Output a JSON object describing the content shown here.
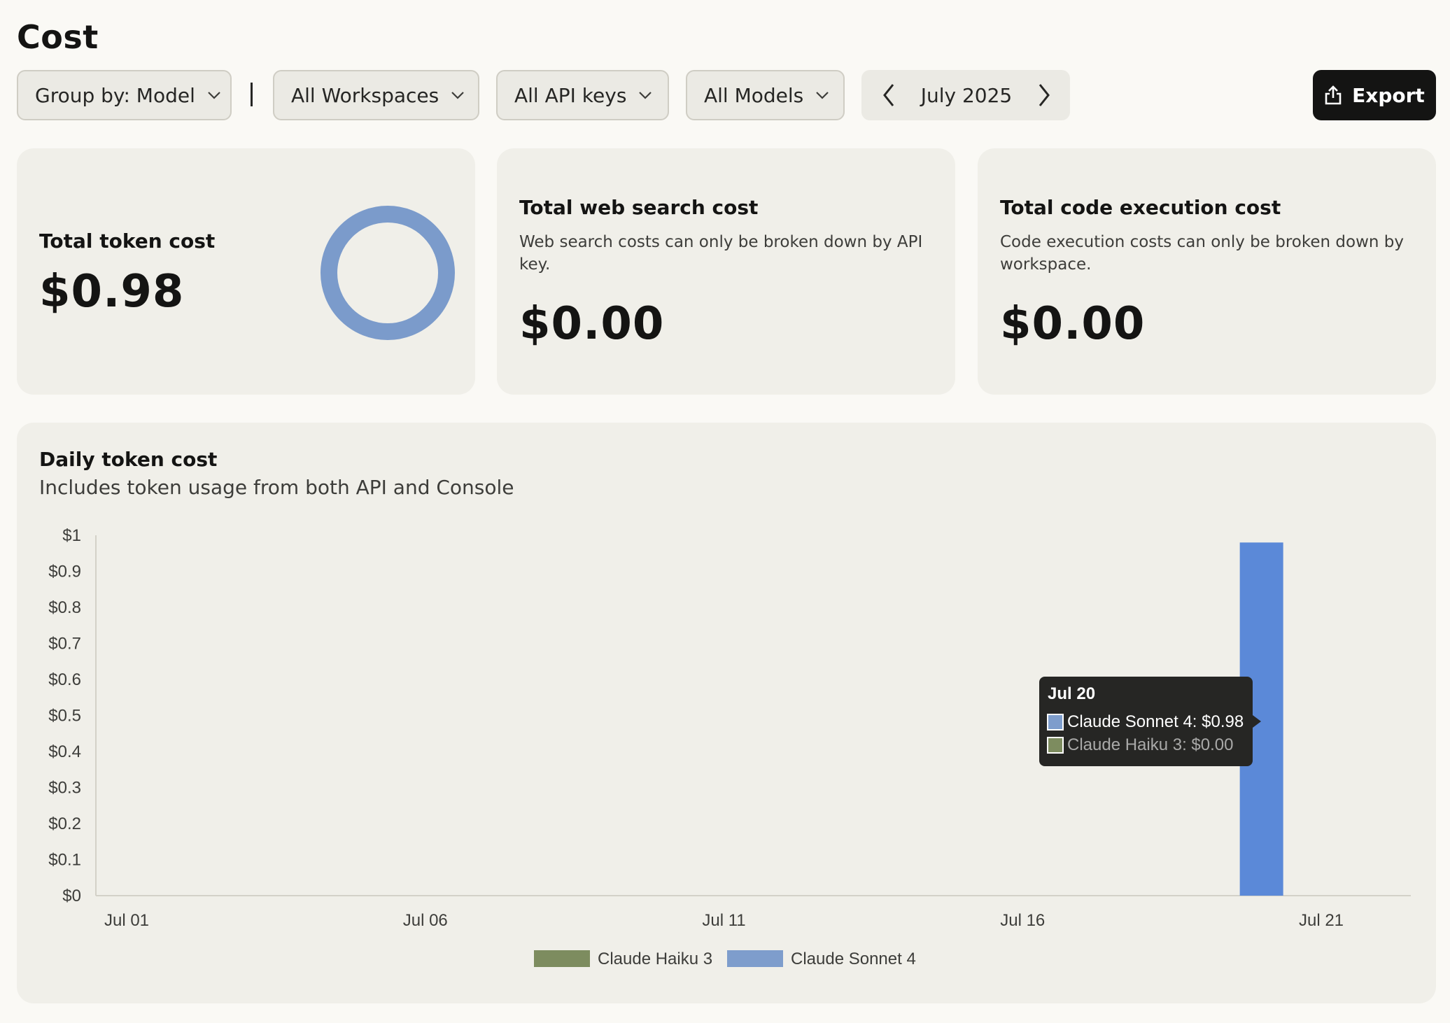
{
  "page": {
    "title": "Cost"
  },
  "toolbar": {
    "group_by": "Group by: Model",
    "workspaces": "All Workspaces",
    "api_keys": "All API keys",
    "models": "All Models",
    "month": "July 2025",
    "export_label": "Export",
    "icons": {
      "dropdown": "chevron-down-icon",
      "prev": "chevron-left-icon",
      "next": "chevron-right-icon",
      "export": "share-upload-icon"
    }
  },
  "cards": {
    "token": {
      "title": "Total token cost",
      "value": "$0.98"
    },
    "web_search": {
      "title": "Total web search cost",
      "description": "Web search costs can only be broken down by API key.",
      "value": "$0.00"
    },
    "code_execution": {
      "title": "Total code execution cost",
      "description": "Code execution costs can only be broken down by workspace.",
      "value": "$0.00"
    }
  },
  "chart_panel": {
    "title": "Daily token cost",
    "subtitle": "Includes token usage from both API and Console"
  },
  "colors": {
    "sonnet": "#5b89d8",
    "sonnet_legend": "#7e9dcc",
    "haiku": "#7d8c5f",
    "donut": "#7b9bcb",
    "tooltip_bg": "#262624"
  },
  "chart_data": {
    "type": "bar",
    "stacked": true,
    "x": [
      "Jul 01",
      "Jul 02",
      "Jul 03",
      "Jul 04",
      "Jul 05",
      "Jul 06",
      "Jul 07",
      "Jul 08",
      "Jul 09",
      "Jul 10",
      "Jul 11",
      "Jul 12",
      "Jul 13",
      "Jul 14",
      "Jul 15",
      "Jul 16",
      "Jul 17",
      "Jul 18",
      "Jul 19",
      "Jul 20",
      "Jul 21"
    ],
    "xticks": [
      "Jul 01",
      "Jul 06",
      "Jul 11",
      "Jul 16",
      "Jul 21"
    ],
    "yticks": [
      "$0",
      "$0.1",
      "$0.2",
      "$0.3",
      "$0.4",
      "$0.5",
      "$0.6",
      "$0.7",
      "$0.8",
      "$0.9",
      "$1"
    ],
    "ylim": [
      0,
      1
    ],
    "series": [
      {
        "name": "Claude Haiku 3",
        "values": [
          0,
          0,
          0,
          0,
          0,
          0,
          0,
          0,
          0,
          0,
          0,
          0,
          0,
          0,
          0,
          0,
          0,
          0,
          0,
          0,
          0
        ]
      },
      {
        "name": "Claude Sonnet 4",
        "values": [
          0,
          0,
          0,
          0,
          0,
          0,
          0,
          0,
          0,
          0,
          0,
          0,
          0,
          0,
          0,
          0,
          0,
          0,
          0,
          0.98,
          0
        ]
      }
    ],
    "legend": [
      "Claude Haiku 3",
      "Claude Sonnet 4"
    ],
    "legend_position": "bottom",
    "grid": false,
    "tooltip": {
      "title": "Jul 20",
      "lines": [
        "Claude Sonnet 4: $0.98",
        "Claude Haiku 3: $0.00"
      ]
    }
  }
}
